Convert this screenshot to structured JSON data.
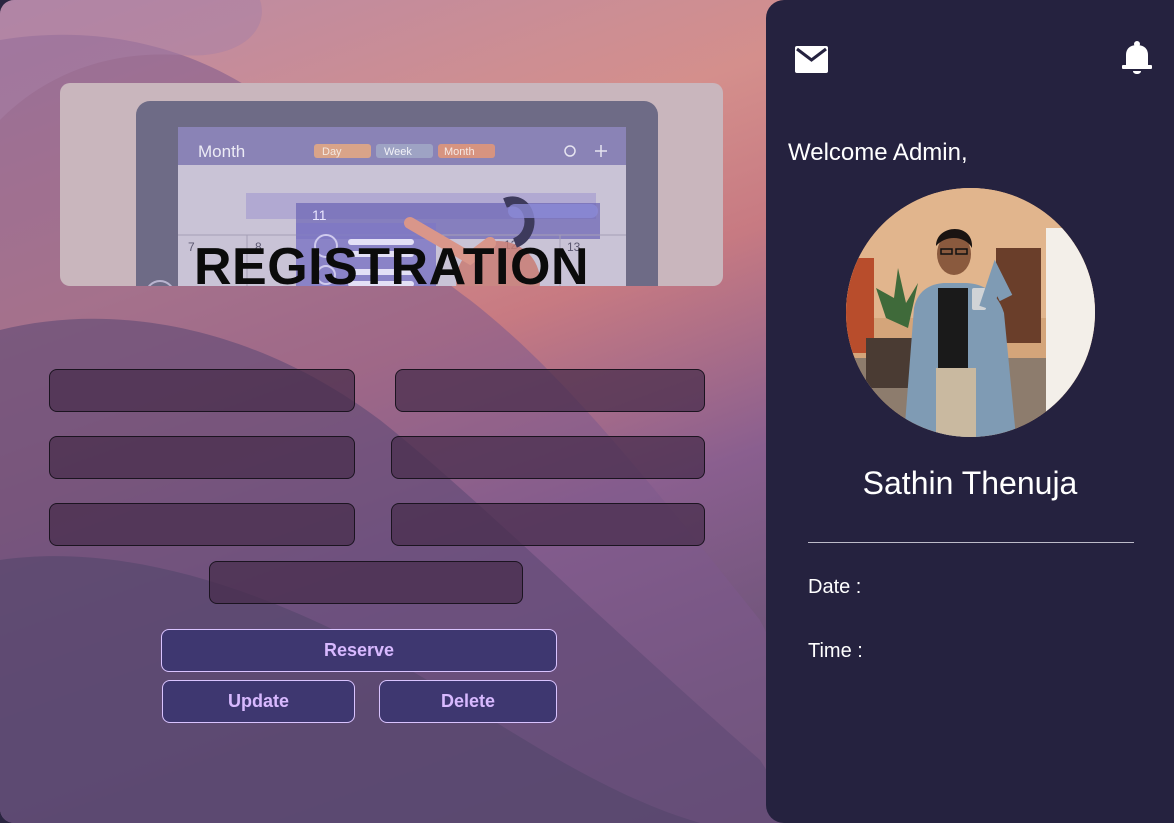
{
  "page": {
    "banner_title": "REGISTRATION"
  },
  "calendar_illustration": {
    "month_label": "Month",
    "chip_day": "Day",
    "chip_week": "Week",
    "chip_month": "Month",
    "date_11": "11",
    "date_7": "7",
    "date_8": "8",
    "date_12": "12",
    "date_13": "13"
  },
  "form": {
    "fields": [
      {
        "placeholder": ""
      },
      {
        "placeholder": ""
      },
      {
        "placeholder": ""
      },
      {
        "placeholder": ""
      },
      {
        "placeholder": ""
      },
      {
        "placeholder": ""
      },
      {
        "placeholder": ""
      }
    ],
    "buttons": {
      "reserve": "Reserve",
      "update": "Update",
      "delete": "Delete"
    }
  },
  "sidebar": {
    "icons": {
      "left": "mail-icon",
      "right": "bell-icon"
    },
    "welcome": "Welcome Admin,",
    "user_name": "Sathin Thenuja",
    "date_label": "Date :",
    "time_label": "Time :"
  },
  "colors": {
    "panel_bg": "#25223f",
    "button_bg": "#3e3770",
    "button_text": "#d8b9ff",
    "field_bg": "#462d4b"
  }
}
